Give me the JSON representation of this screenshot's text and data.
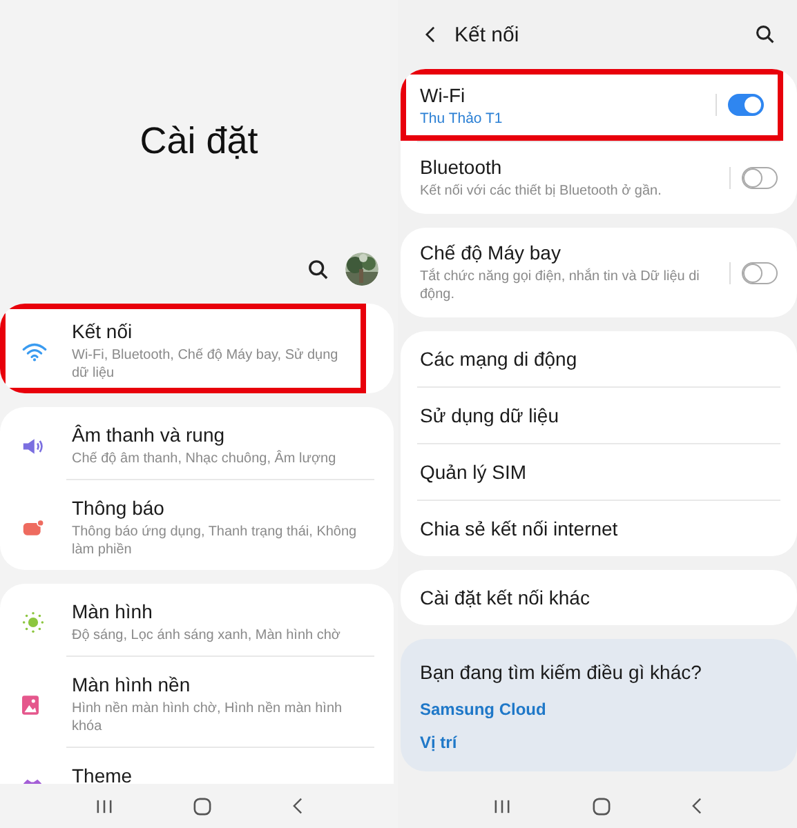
{
  "left": {
    "title": "Cài đặt",
    "groups": [
      [
        {
          "kind": "wifi",
          "title": "Kết nối",
          "subtitle": "Wi-Fi, Bluetooth, Chế độ Máy bay, Sử dụng dữ liệu",
          "highlighted": true
        }
      ],
      [
        {
          "kind": "sound",
          "title": "Âm thanh và rung",
          "subtitle": "Chế độ âm thanh, Nhạc chuông, Âm lượng",
          "highlighted": false
        },
        {
          "kind": "notification",
          "title": "Thông báo",
          "subtitle": "Thông báo ứng dụng, Thanh trạng thái, Không làm phiền",
          "highlighted": false
        }
      ],
      [
        {
          "kind": "display",
          "title": "Màn hình",
          "subtitle": "Độ sáng, Lọc ánh sáng xanh, Màn hình chờ",
          "highlighted": false
        },
        {
          "kind": "wallpaper",
          "title": "Màn hình nền",
          "subtitle": "Hình nền màn hình chờ, Hình nền màn hình khóa",
          "highlighted": false
        },
        {
          "kind": "theme",
          "title": "Theme",
          "highlighted": false
        }
      ]
    ]
  },
  "right": {
    "header": {
      "title": "Kết nối"
    },
    "groups": [
      [
        {
          "kind": "toggle",
          "title": "Wi-Fi",
          "value": "Thu Thảo T1",
          "on": true,
          "highlighted": true
        },
        {
          "kind": "toggle",
          "title": "Bluetooth",
          "subtitle": "Kết nối với các thiết bị Bluetooth ở gần.",
          "on": false,
          "highlighted": false
        }
      ],
      [
        {
          "kind": "toggle",
          "title": "Chế độ Máy bay",
          "subtitle": "Tắt chức năng gọi điện, nhắn tin và Dữ liệu di động.",
          "on": false,
          "highlighted": false
        }
      ],
      [
        {
          "kind": "link",
          "title": "Các mạng di động"
        },
        {
          "kind": "link",
          "title": "Sử dụng dữ liệu"
        },
        {
          "kind": "link",
          "title": "Quản lý SIM"
        },
        {
          "kind": "link",
          "title": "Chia sẻ kết nối internet"
        }
      ],
      [
        {
          "kind": "link",
          "title": "Cài đặt kết nối khác"
        }
      ]
    ],
    "suggestions": {
      "title": "Bạn đang tìm kiếm điều gì khác?",
      "links": [
        "Samsung Cloud",
        "Vị trí"
      ]
    }
  }
}
